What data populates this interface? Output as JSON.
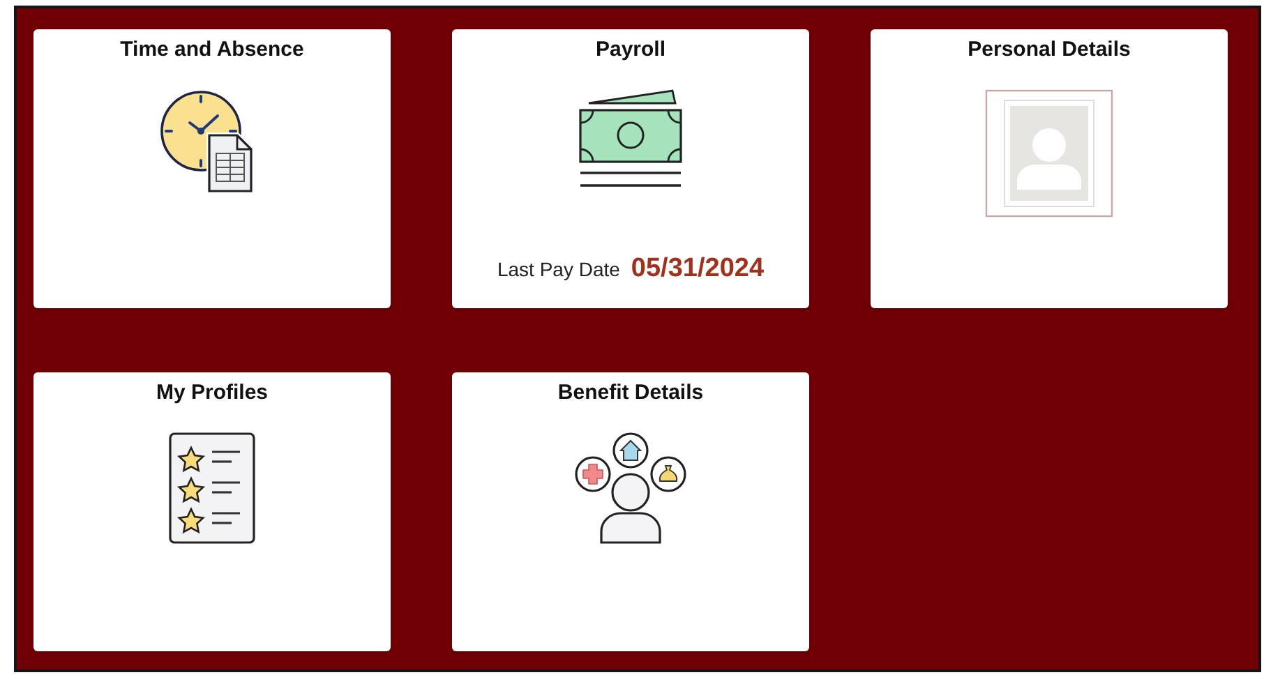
{
  "tiles": [
    {
      "title": "Time and Absence",
      "kind": "clock"
    },
    {
      "title": "Payroll",
      "kind": "money",
      "footer": {
        "label": "Last Pay Date",
        "value": "05/31/2024"
      }
    },
    {
      "title": "Personal Details",
      "kind": "photo"
    },
    {
      "title": "My Profiles",
      "kind": "profiles"
    },
    {
      "title": "Benefit Details",
      "kind": "benefits"
    }
  ]
}
